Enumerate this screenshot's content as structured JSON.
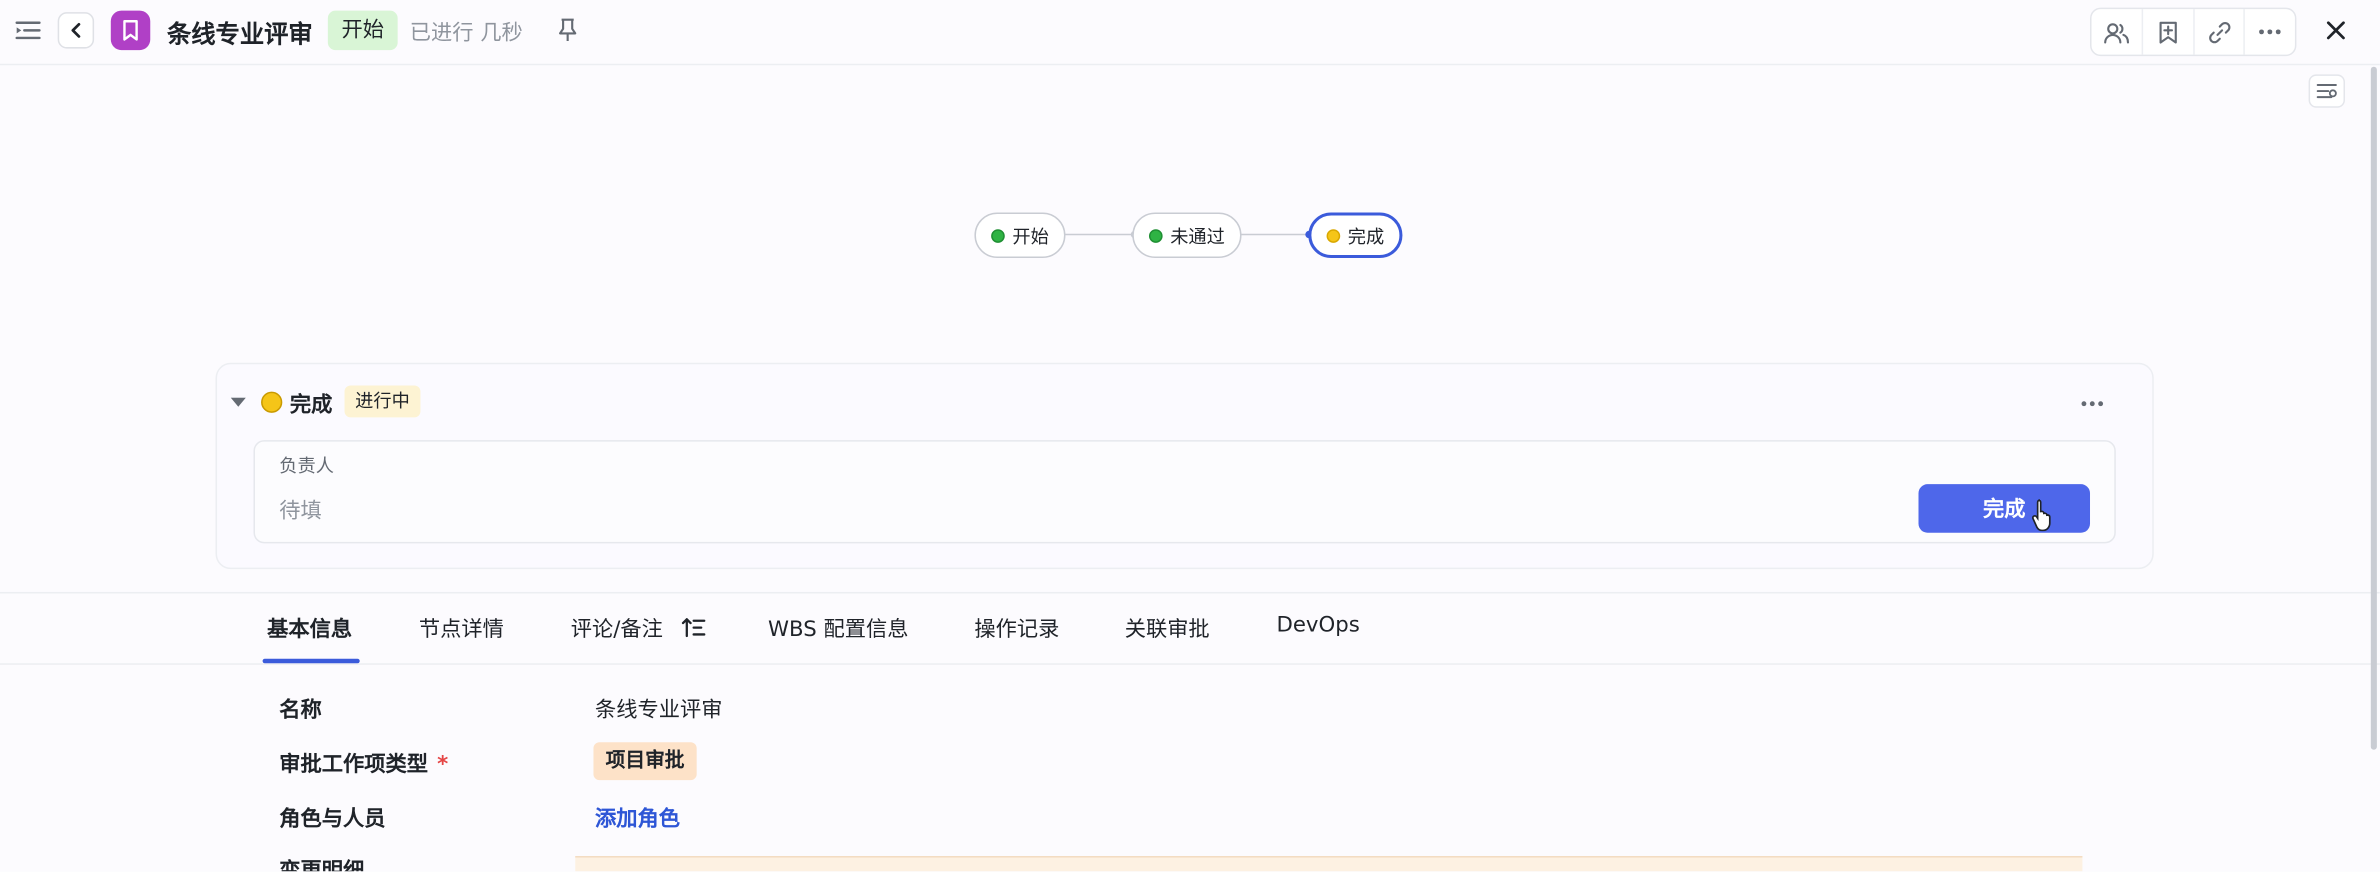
{
  "header": {
    "title": "条线专业评审",
    "status": "开始",
    "elapsed": "已进行 几秒",
    "icons": [
      "sidebar-toggle-icon",
      "back-icon",
      "bookmark-icon",
      "pin-icon",
      "members-icon",
      "save-icon",
      "link-icon",
      "more-icon",
      "close-icon"
    ],
    "type_icon_color": "#b040c6"
  },
  "workflow": {
    "nodes": [
      {
        "label": "开始",
        "state": "green"
      },
      {
        "label": "未通过",
        "state": "green"
      },
      {
        "label": "完成",
        "state": "yellow",
        "active": true
      }
    ]
  },
  "node_card": {
    "name": "完成",
    "status": "进行中",
    "owner_label": "负责人",
    "owner_value": "待填",
    "complete_button": "完成"
  },
  "tabs": [
    {
      "label": "基本信息",
      "active": true
    },
    {
      "label": "节点详情"
    },
    {
      "label": "评论/备注"
    },
    {
      "label": "WBS 配置信息"
    },
    {
      "label": "操作记录"
    },
    {
      "label": "关联审批"
    },
    {
      "label": "DevOps"
    }
  ],
  "fields": {
    "name_label": "名称",
    "name_value": "条线专业评审",
    "type_label": "审批工作项类型",
    "type_required": "*",
    "type_value": "项目审批",
    "roles_label": "角色与人员",
    "roles_action": "添加角色",
    "change_label": "变更明细"
  },
  "colors": {
    "accent": "#3b5bdb",
    "button": "#4e67ea",
    "status_start_bg": "#d9f5d6",
    "in_progress_bg": "#fdf3d3",
    "type_tag_bg": "#fde2c8"
  }
}
